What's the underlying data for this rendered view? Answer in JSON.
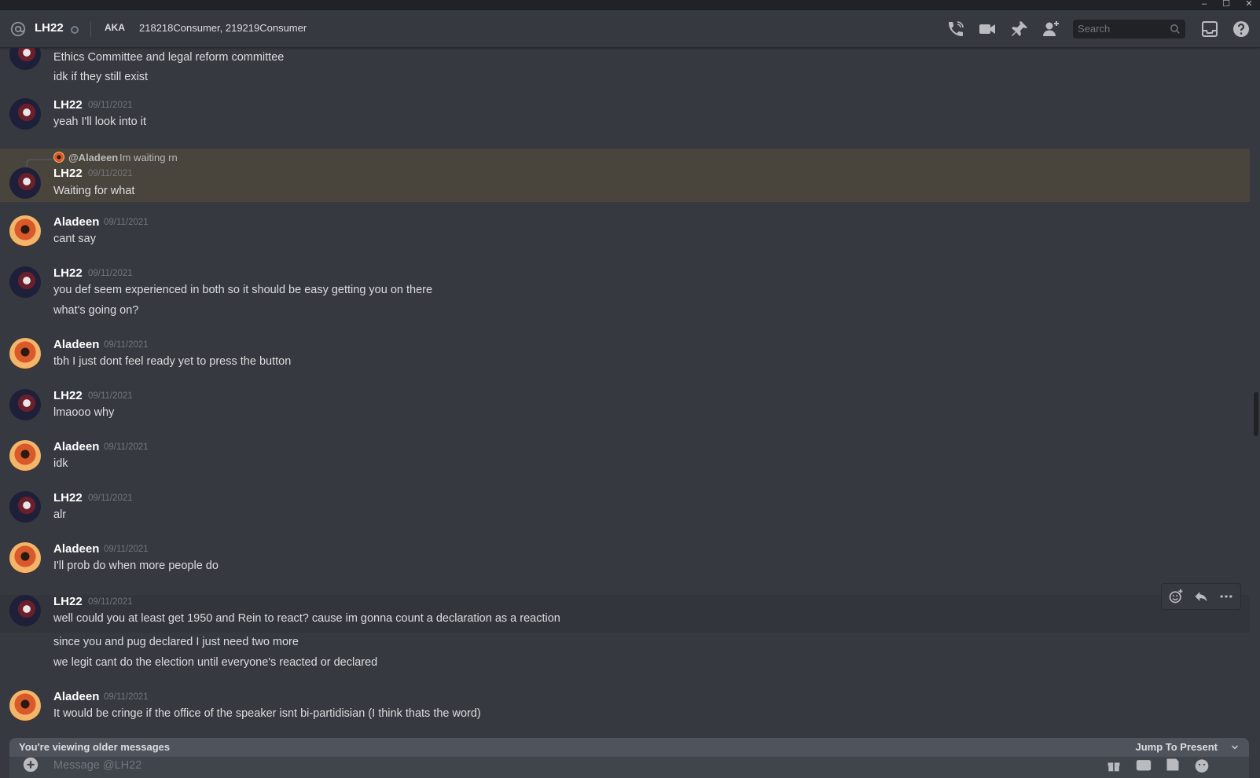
{
  "window": {
    "controls": {
      "minimize": "–",
      "maximize": "☐",
      "close": "✕"
    }
  },
  "header": {
    "name": "LH22",
    "aka_label": "AKA",
    "aka_names": "218218Consumer, 219219Consumer",
    "search_placeholder": "Search",
    "icons": [
      "phone-call-icon",
      "video-call-icon",
      "pin-icon",
      "add-friend-icon",
      "inbox-icon",
      "help-icon"
    ]
  },
  "messages": [
    {
      "lines": [
        "Ethics Committee and legal reform committee",
        "idk if they still exist"
      ]
    },
    {
      "author": "LH22",
      "timestamp": "09/11/2021",
      "lines": [
        "yeah I'll look into it"
      ]
    },
    {
      "author": "LH22",
      "timestamp": "09/11/2021",
      "reply": {
        "name": "@Aladeen",
        "text": "Im waiting rn"
      },
      "lines": [
        "Waiting for what"
      ]
    },
    {
      "author": "Aladeen",
      "timestamp": "09/11/2021",
      "lines": [
        "cant say"
      ]
    },
    {
      "author": "LH22",
      "timestamp": "09/11/2021",
      "lines": [
        "you def seem experienced in both so it should be easy getting you on there",
        "what's going on?"
      ]
    },
    {
      "author": "Aladeen",
      "timestamp": "09/11/2021",
      "lines": [
        "tbh I just dont feel ready yet to press the button"
      ]
    },
    {
      "author": "LH22",
      "timestamp": "09/11/2021",
      "lines": [
        "lmaooo why"
      ]
    },
    {
      "author": "Aladeen",
      "timestamp": "09/11/2021",
      "lines": [
        "idk"
      ]
    },
    {
      "author": "LH22",
      "timestamp": "09/11/2021",
      "lines": [
        "alr"
      ]
    },
    {
      "author": "Aladeen",
      "timestamp": "09/11/2021",
      "lines": [
        "I'll prob do when more people do"
      ]
    },
    {
      "author": "LH22",
      "timestamp": "09/11/2021",
      "lines": [
        "well could you at least get 1950 and Rein to react? cause im gonna count a declaration as a reaction",
        "since you and pug declared I just need two more",
        "we legit cant do the election until everyone's reacted or declared"
      ]
    },
    {
      "author": "Aladeen",
      "timestamp": "09/11/2021",
      "lines": [
        "It would be cringe if the office of the speaker isnt bi-partidisian (I think thats the word)"
      ]
    }
  ],
  "older_bar": {
    "text": "You're viewing older messages",
    "jump_label": "Jump To Present"
  },
  "composer": {
    "placeholder": "Message @LH22",
    "icons": [
      "gift-icon",
      "gif-icon",
      "sticker-icon",
      "emoji-icon"
    ]
  },
  "colors": {
    "background": "#36393f",
    "highlight": "#49443c",
    "muted": "#72767d",
    "text": "#dcddde"
  }
}
